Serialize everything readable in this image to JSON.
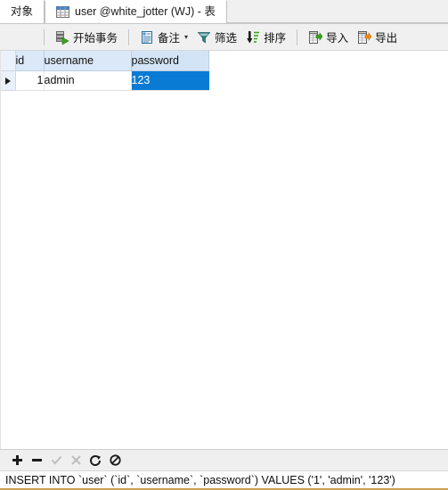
{
  "tabs": [
    {
      "label": "对象",
      "icon": "",
      "active": false
    },
    {
      "label": "user @white_jotter (WJ) - 表",
      "icon": "table-grid-icon",
      "active": true
    }
  ],
  "toolbar": {
    "start_transaction": {
      "label": "开始事务",
      "icon": "transaction-icon"
    },
    "note": {
      "label": "备注",
      "icon": "note-document-icon",
      "caret": "▾"
    },
    "filter": {
      "label": "筛选",
      "icon": "funnel-filter-icon"
    },
    "sort": {
      "label": "排序",
      "icon": "sort-descending-icon"
    },
    "import": {
      "label": "导入",
      "icon": "import-green-arrow-icon"
    },
    "export": {
      "label": "导出",
      "icon": "export-orange-arrow-icon"
    }
  },
  "grid": {
    "columns": [
      "id",
      "username",
      "password"
    ],
    "selected_column": "password",
    "rows": [
      {
        "marker": "▶",
        "id": "1",
        "username": "admin",
        "password": "123"
      }
    ],
    "selected_cell": {
      "row": 0,
      "column": "password"
    },
    "selection_color": "#0a7bd4",
    "header_color": "#dbe8f7"
  },
  "navbar": {
    "buttons": [
      {
        "name": "add-record",
        "glyph": "✚",
        "enabled": true
      },
      {
        "name": "delete-record",
        "glyph": "▬",
        "enabled": true
      },
      {
        "name": "apply-change",
        "glyph": "✓",
        "enabled": false
      },
      {
        "name": "cancel-change",
        "glyph": "✕",
        "enabled": false
      },
      {
        "name": "refresh",
        "glyph": "⟳",
        "enabled": true
      },
      {
        "name": "stop",
        "glyph": "⊘",
        "enabled": true
      }
    ]
  },
  "statusbar": {
    "sql": "INSERT INTO `user` (`id`, `username`, `password`) VALUES ('1', 'admin', '123')",
    "accent_color": "#c8a04a"
  }
}
